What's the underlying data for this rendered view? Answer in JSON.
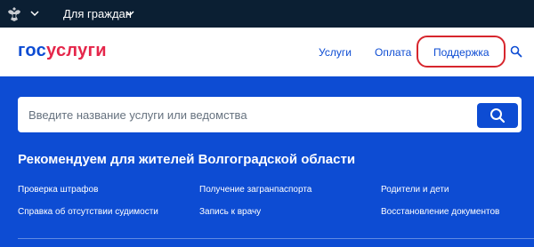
{
  "topbar": {
    "emblem_icon": "russia-emblem-icon",
    "audience_label": "Для граждан"
  },
  "header": {
    "logo_part1": "гос",
    "logo_part2": "услуги",
    "nav": {
      "services": "Услуги",
      "payment": "Оплата",
      "support": "Поддержка"
    },
    "search_icon": "search-icon"
  },
  "search": {
    "placeholder": "Введите название услуги или ведомства",
    "button_icon": "search-icon"
  },
  "recommendations": {
    "title": "Рекомендуем для жителей Волгоградской области",
    "links": [
      "Проверка штрафов",
      "Получение загранпаспорта",
      "Родители и дети",
      "Справка об отсутствии судимости",
      "Запись к врачу",
      "Восстановление документов"
    ]
  },
  "colors": {
    "primary_blue": "#0d4cd3",
    "topbar_dark": "#0b1f33",
    "logo_red": "#e5264a",
    "highlight_red": "#d7262d"
  }
}
